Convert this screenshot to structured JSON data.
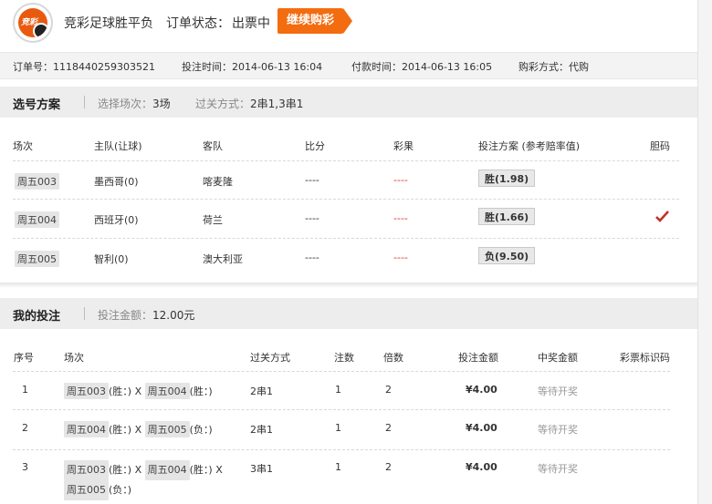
{
  "header": {
    "logo_text": "竞彩",
    "title": "竞彩足球胜平负",
    "status_label": "订单状态：",
    "status_value": "出票中",
    "continue_button": "继续购彩"
  },
  "order_info": {
    "order_no": "订单号：1118440259303521",
    "bet_time": "投注时间：2014-06-13 16:04",
    "pay_time": "付款时间：2014-06-13 16:05",
    "buy_method": "购彩方式：代购"
  },
  "scheme": {
    "heading": "选号方案",
    "matches_label": "选择场次：",
    "matches_value": "3场",
    "pass_label": "过关方式：",
    "pass_value": "2串1,3串1",
    "columns": [
      "场次",
      "主队(让球)",
      "客队",
      "比分",
      "彩果",
      "投注方案 (参考赔率值)",
      "胆码"
    ],
    "rows": [
      {
        "match": "周五003",
        "home": "墨西哥(0)",
        "away": "喀麦隆",
        "score": "----",
        "result": "----",
        "pick": "胜(1.98)",
        "banker": false
      },
      {
        "match": "周五004",
        "home": "西班牙(0)",
        "away": "荷兰",
        "score": "----",
        "result": "----",
        "pick": "胜(1.66)",
        "banker": true
      },
      {
        "match": "周五005",
        "home": "智利(0)",
        "away": "澳大利亚",
        "score": "----",
        "result": "----",
        "pick": "负(9.50)",
        "banker": false
      }
    ]
  },
  "bets": {
    "heading": "我的投注",
    "amount_label": "投注金额：",
    "amount_value": "12.00元",
    "columns": [
      "序号",
      "场次",
      "过关方式",
      "注数",
      "倍数",
      "投注金额",
      "中奖金额",
      "彩票标识码"
    ],
    "rows": [
      {
        "no": "1",
        "m1": "周五003",
        "r1": "(胜：)",
        "sep1": "X",
        "m2": "周五004",
        "r2": "(胜：)",
        "pass": "2串1",
        "count": "1",
        "mult": "2",
        "amount": "¥4.00",
        "prize": "等待开奖"
      },
      {
        "no": "2",
        "m1": "周五004",
        "r1": "(胜：)",
        "sep1": "X",
        "m2": "周五005",
        "r2": "(负：)",
        "pass": "2串1",
        "count": "1",
        "mult": "2",
        "amount": "¥4.00",
        "prize": "等待开奖"
      },
      {
        "no": "3",
        "m1": "周五003",
        "r1": "(胜：)",
        "sep1": "X",
        "m2": "周五004",
        "r2": "(胜：)",
        "sep2": "X",
        "m3": "周五005",
        "r3": "(负：)",
        "pass": "3串1",
        "count": "1",
        "mult": "2",
        "amount": "¥4.00",
        "prize": "等待开奖"
      }
    ]
  },
  "icons": {
    "banker_check": "check-icon"
  },
  "colors": {
    "accent": "#f36c10",
    "check": "#c0312b"
  }
}
